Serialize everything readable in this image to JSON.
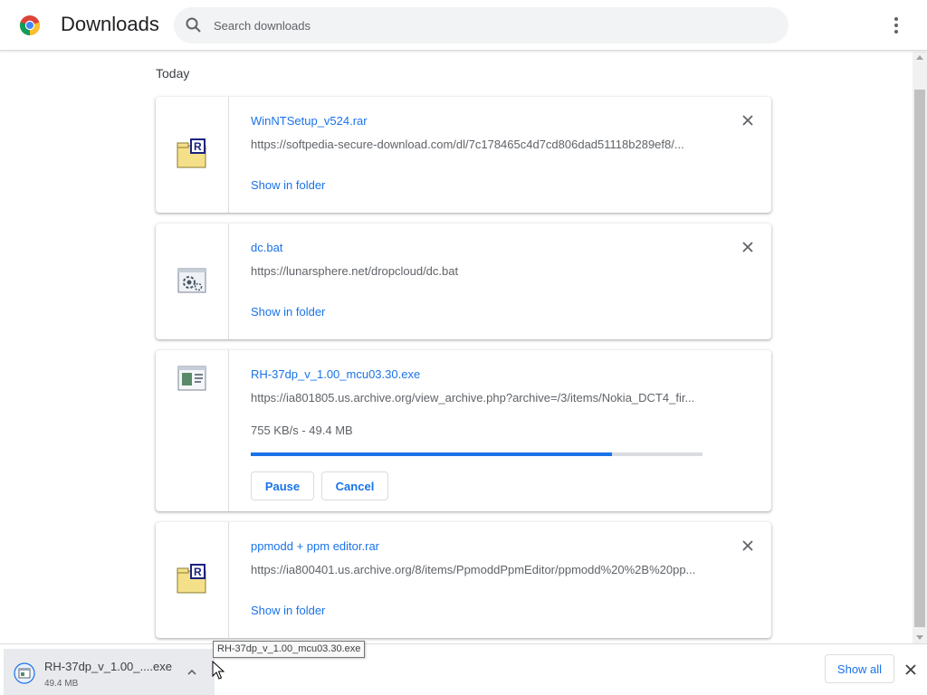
{
  "header": {
    "title": "Downloads",
    "search_placeholder": "Search downloads",
    "logo_icon": "chrome-logo-icon",
    "menu_icon": "more-vert-icon"
  },
  "section": {
    "date_label": "Today"
  },
  "downloads": [
    {
      "file_name": "WinNTSetup_v524.rar",
      "url": "https://softpedia-secure-download.com/dl/7c178465c4d7cd806dad51118b289ef8/...",
      "action": "Show in folder",
      "icon": "rar-archive-icon"
    },
    {
      "file_name": "dc.bat",
      "url": "https://lunarsphere.net/dropcloud/dc.bat",
      "action": "Show in folder",
      "icon": "batch-file-icon"
    },
    {
      "file_name": "RH-37dp_v_1.00_mcu03.30.exe",
      "url": "https://ia801805.us.archive.org/view_archive.php?archive=/3/items/Nokia_DCT4_fir...",
      "status": "755 KB/s - 49.4 MB",
      "progress": 0.8,
      "pause_label": "Pause",
      "cancel_label": "Cancel",
      "icon": "executable-file-icon"
    },
    {
      "file_name": "ppmodd + ppm editor.rar",
      "url": "https://ia800401.us.archive.org/8/items/PpmoddPpmEditor/ppmodd%20%2B%20pp...",
      "action": "Show in folder",
      "icon": "rar-archive-icon"
    }
  ],
  "shelf": {
    "item_name": "RH-37dp_v_1.00_....exe",
    "item_size": "49.4 MB",
    "show_all_label": "Show all",
    "tooltip": "RH-37dp_v_1.00_mcu03.30.exe"
  },
  "colors": {
    "accent": "#1a73e8",
    "progress_track": "#dadce0",
    "text_secondary": "#5f6368"
  }
}
